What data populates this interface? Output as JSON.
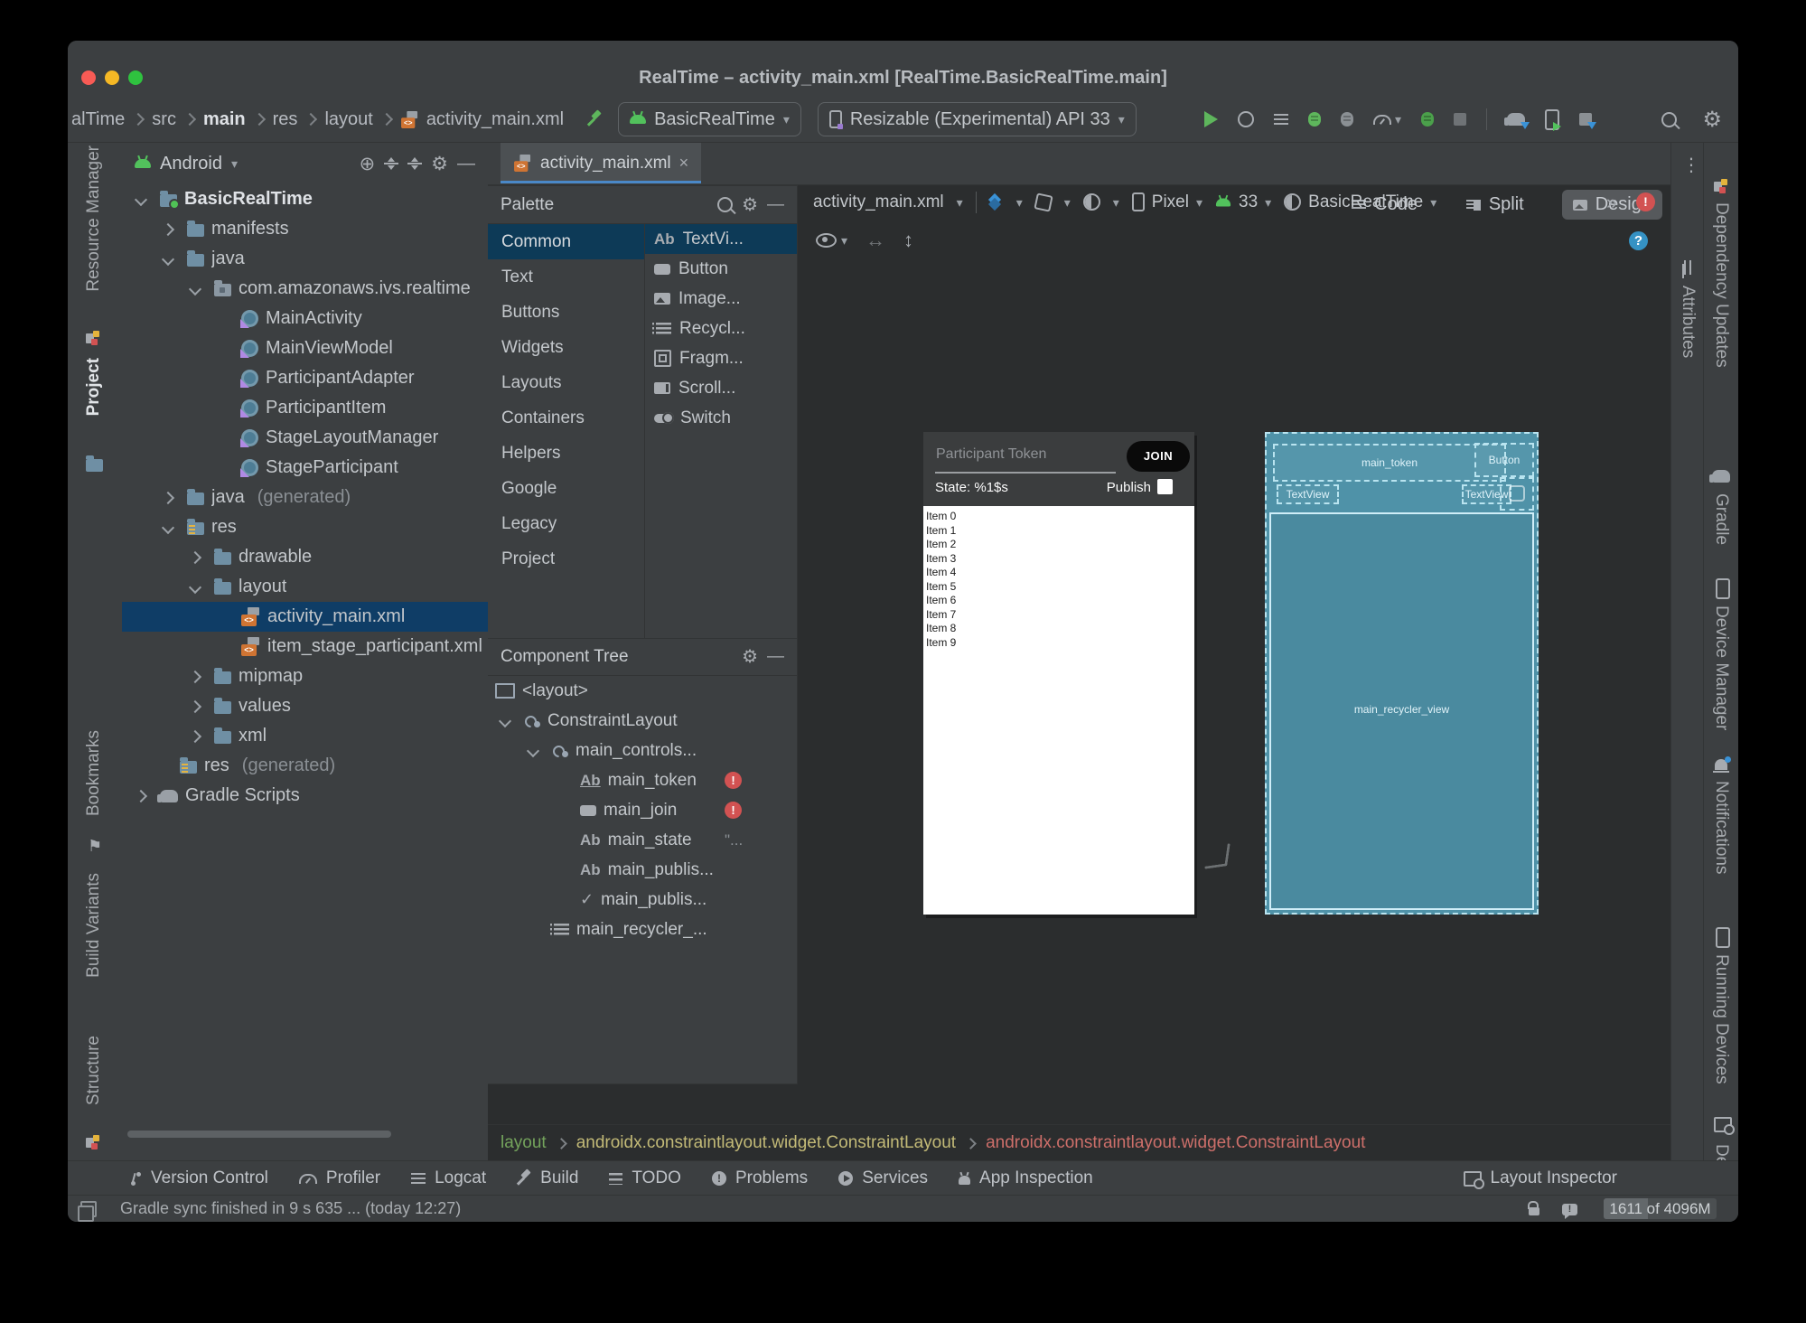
{
  "titlebar": {
    "title": "RealTime – activity_main.xml [RealTime.BasicRealTime.main]"
  },
  "toolbar": {
    "breadcrumbs": [
      "alTime",
      "src",
      "main",
      "res",
      "layout",
      "activity_main.xml"
    ],
    "run_config": "BasicRealTime",
    "device": "Resizable (Experimental) API 33"
  },
  "left_strip": {
    "items": [
      "Resource Manager",
      "Project",
      "Bookmarks",
      "Build Variants",
      "Structure"
    ]
  },
  "right_strip": {
    "attributes": "Attributes",
    "items": [
      "Dependency Updates",
      "Gradle",
      "Device Manager",
      "Notifications",
      "Running Devices",
      "Device File E"
    ]
  },
  "project": {
    "mode": "Android",
    "tree": [
      {
        "label": "BasicRealTime"
      },
      {
        "label": "manifests"
      },
      {
        "label": "java"
      },
      {
        "label": "com.amazonaws.ivs.realtime"
      },
      {
        "label": "MainActivity"
      },
      {
        "label": "MainViewModel"
      },
      {
        "label": "ParticipantAdapter"
      },
      {
        "label": "ParticipantItem"
      },
      {
        "label": "StageLayoutManager"
      },
      {
        "label": "StageParticipant"
      },
      {
        "label": "java",
        "suffix": "(generated)"
      },
      {
        "label": "res"
      },
      {
        "label": "drawable"
      },
      {
        "label": "layout"
      },
      {
        "label": "activity_main.xml"
      },
      {
        "label": "item_stage_participant.xml"
      },
      {
        "label": "mipmap"
      },
      {
        "label": "values"
      },
      {
        "label": "xml"
      },
      {
        "label": "res",
        "suffix": "(generated)"
      },
      {
        "label": "Gradle Scripts"
      }
    ]
  },
  "editor": {
    "tab": "activity_main.xml",
    "code": "Code",
    "split": "Split",
    "design": "Design"
  },
  "palette": {
    "title": "Palette",
    "categories": [
      "Common",
      "Text",
      "Buttons",
      "Widgets",
      "Layouts",
      "Containers",
      "Helpers",
      "Google",
      "Legacy",
      "Project"
    ],
    "items": [
      "TextVi...",
      "Button",
      "Image...",
      "Recycl...",
      "Fragm...",
      "Scroll...",
      "Switch"
    ]
  },
  "component_tree": {
    "title": "Component Tree",
    "nodes": [
      {
        "label": "<layout>"
      },
      {
        "label": "ConstraintLayout"
      },
      {
        "label": "main_controls..."
      },
      {
        "label": "main_token"
      },
      {
        "label": "main_join"
      },
      {
        "label": "main_state",
        "suffix": "\"..."
      },
      {
        "label": "main_publis..."
      },
      {
        "label": "main_publis..."
      },
      {
        "label": "main_recycler_..."
      }
    ]
  },
  "design_bar": {
    "file": "activity_main.xml",
    "device": "Pixel",
    "api": "33",
    "theme": "BasicRealTime"
  },
  "preview": {
    "hint": "Participant Token",
    "join": "JOIN",
    "state": "State: %1$s",
    "publish": "Publish",
    "items": [
      "Item 0",
      "Item 1",
      "Item 2",
      "Item 3",
      "Item 4",
      "Item 5",
      "Item 6",
      "Item 7",
      "Item 8",
      "Item 9"
    ]
  },
  "blueprint": {
    "token": "main_token",
    "button": "Button",
    "tv1": "TextView",
    "tv2": "TextView",
    "recycler": "main_recycler_view"
  },
  "xml_breadcrumb": {
    "a": "layout",
    "b": "androidx.constraintlayout.widget.ConstraintLayout",
    "c": "androidx.constraintlayout.widget.ConstraintLayout"
  },
  "bottom_bar": {
    "items": [
      "Version Control",
      "Profiler",
      "Logcat",
      "Build",
      "TODO",
      "Problems",
      "Services",
      "App Inspection"
    ],
    "right": "Layout Inspector"
  },
  "status": {
    "message": "Gradle sync finished in 9 s 635 ... (today 12:27)",
    "memory": "1611 of 4096M"
  },
  "icons": {
    "gear": "⚙",
    "minus": "—",
    "close": "×",
    "kebab": "⋮",
    "check": "✓",
    "more": "»",
    "help": "?",
    "error": "!",
    "ab": "Ab",
    "target": "⊕",
    "arrow_h": "↔",
    "arrow_v": "↕",
    "xml_code": "<>",
    "caret": "▾",
    "bookmark": "⚑"
  },
  "colors": {
    "selection_blue": "#0f3d66",
    "palette_selection": "#0d3a57",
    "tab_underline": "#4a88c7",
    "blueprint_teal": "#4f92a8",
    "android_green": "#52c15c",
    "error_red": "#d25252",
    "crumb_layout": "#74a35c",
    "crumb_mid": "#c3ba77",
    "crumb_last": "#cd6f6a",
    "traffic_red": "#f85b55",
    "traffic_yellow": "#f5b825",
    "traffic_green": "#2fc23f"
  }
}
